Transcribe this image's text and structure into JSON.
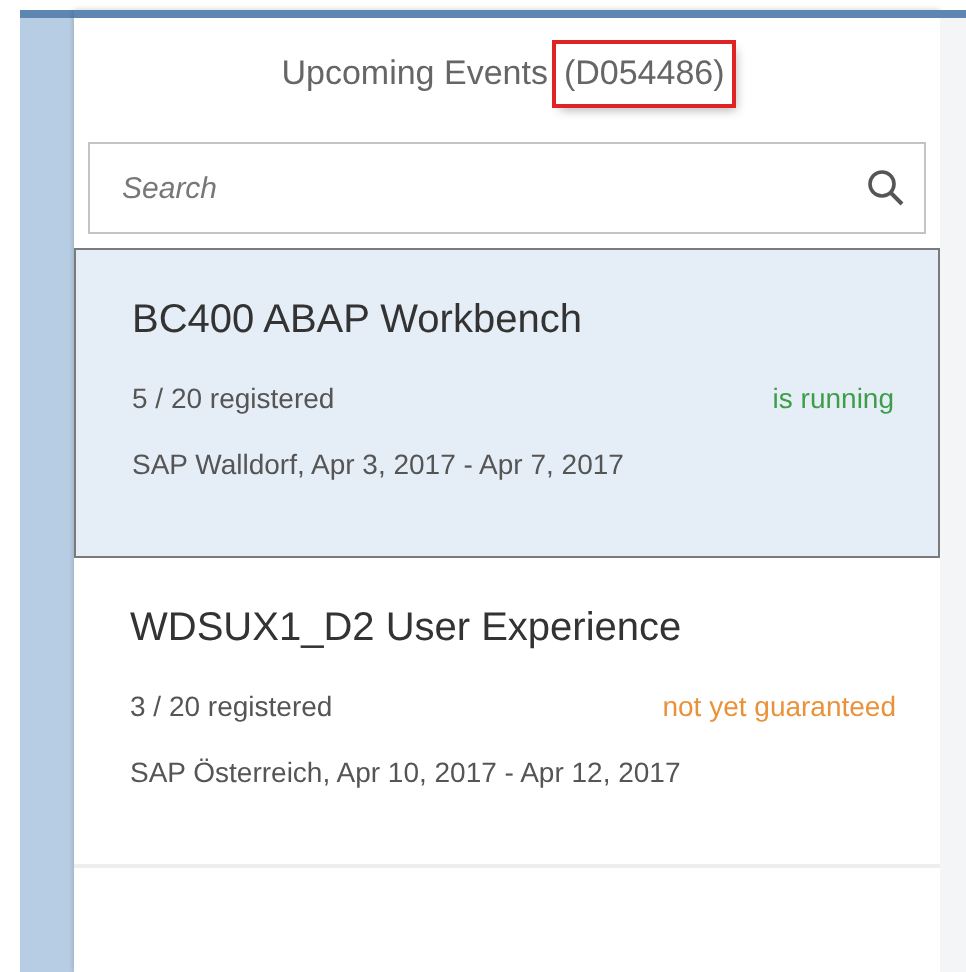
{
  "header": {
    "title": "Upcoming Events",
    "user_id": "(D054486)",
    "user_id_highlighted": true
  },
  "search": {
    "placeholder": "Search"
  },
  "events": [
    {
      "title": "BC400 ABAP Workbench",
      "registered": "5 / 20 registered",
      "status": "is running",
      "color": "#3d9e4a",
      "location_dates": "SAP Walldorf, Apr 3, 2017 - Apr 7, 2017",
      "selected": true
    },
    {
      "title": "WDSUX1_D2 User Experience",
      "registered": "3 / 20 registered",
      "status": "not yet guaranteed",
      "color": "#e9923a",
      "location_dates": "SAP Österreich, Apr 10, 2017 - Apr 12, 2017",
      "selected": false
    }
  ]
}
